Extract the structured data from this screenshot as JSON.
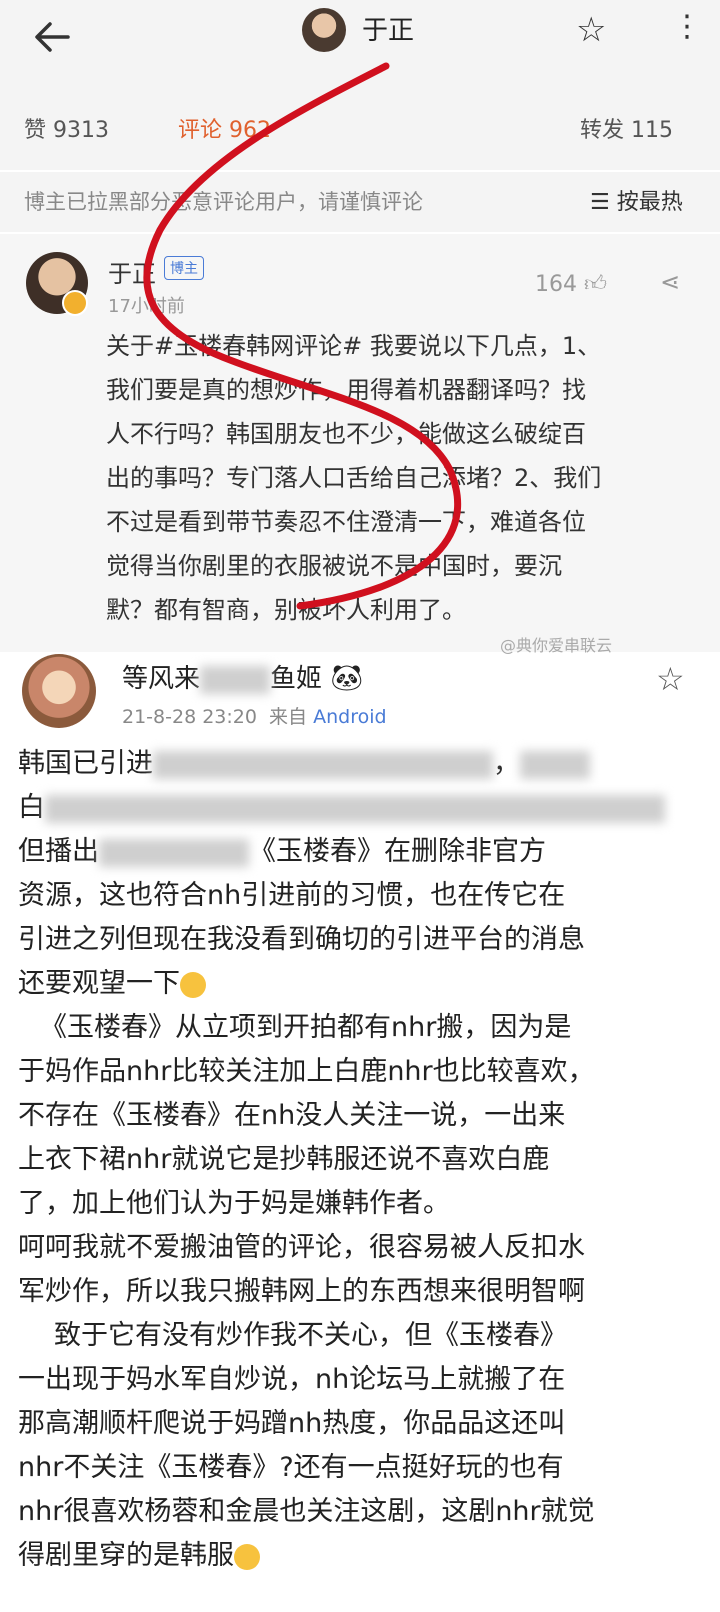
{
  "header": {
    "title": "于正"
  },
  "stats": {
    "likes_label": "赞",
    "likes": "9313",
    "comments_label": "评论",
    "comments": "962",
    "reposts_label": "转发",
    "reposts": "115"
  },
  "notice": {
    "text": "博主已拉黑部分恶意评论用户，请谨慎评论",
    "sort": "按最热"
  },
  "comment": {
    "author": "于正",
    "tag": "博主",
    "time": "17小时前",
    "likes": "164",
    "lines": [
      "关于#玉楼春韩网评论# 我要说以下几点，1、",
      "我们要是真的想炒作，用得着机器翻译吗？找",
      "人不行吗？韩国朋友也不少，能做这么破绽百",
      "出的事吗？专门落人口舌给自己添堵？2、我们",
      "不过是看到带节奏忍不住澄清一下，难道各位",
      "觉得当你剧里的衣服被说不是中国时，要沉",
      "默？都有智商，别被坏人利用了。"
    ]
  },
  "watermark": "@典你爱串联云",
  "post": {
    "author_a": "等风来",
    "author_b": "鱼姬",
    "date": "21-8-28 23:20",
    "source_prefix": "来自",
    "source": "Android",
    "lines": [
      "韩国已引进",
      "白",
      "但播出",
      "资源，这也符合nh引进前的习惯，也在传它在",
      "引进之列但现在我没看到确切的引进平台的消息",
      "还要观望一下",
      "《玉楼春》从立项到开拍都有nhr搬，因为是",
      "于妈作品nhr比较关注加上白鹿nhr也比较喜欢，",
      "不存在《玉楼春》在nh没人关注一说，一出来",
      "上衣下裙nhr就说它是抄韩服还说不喜欢白鹿",
      "了，加上他们认为于妈是嫌韩作者。",
      "呵呵我就不爱搬油管的评论，很容易被人反扣水",
      "军炒作，所以我只搬韩网上的东西想来很明智啊",
      "致于它有没有炒作我不关心，但《玉楼春》",
      "一出现于妈水军自炒说，nh论坛马上就搬了在",
      "那高潮顺杆爬说于妈蹭nh热度，你品品这还叫",
      "nhr不关注《玉楼春》?还有一点挺好玩的也有",
      "nhr很喜欢杨蓉和金晨也关注这剧，这剧nhr就觉",
      "得剧里穿的是韩服"
    ],
    "line3_tail": "《玉楼春》在删除非官方"
  },
  "colors": {
    "link": "#4a7bd6",
    "scribble": "#d0101e"
  }
}
